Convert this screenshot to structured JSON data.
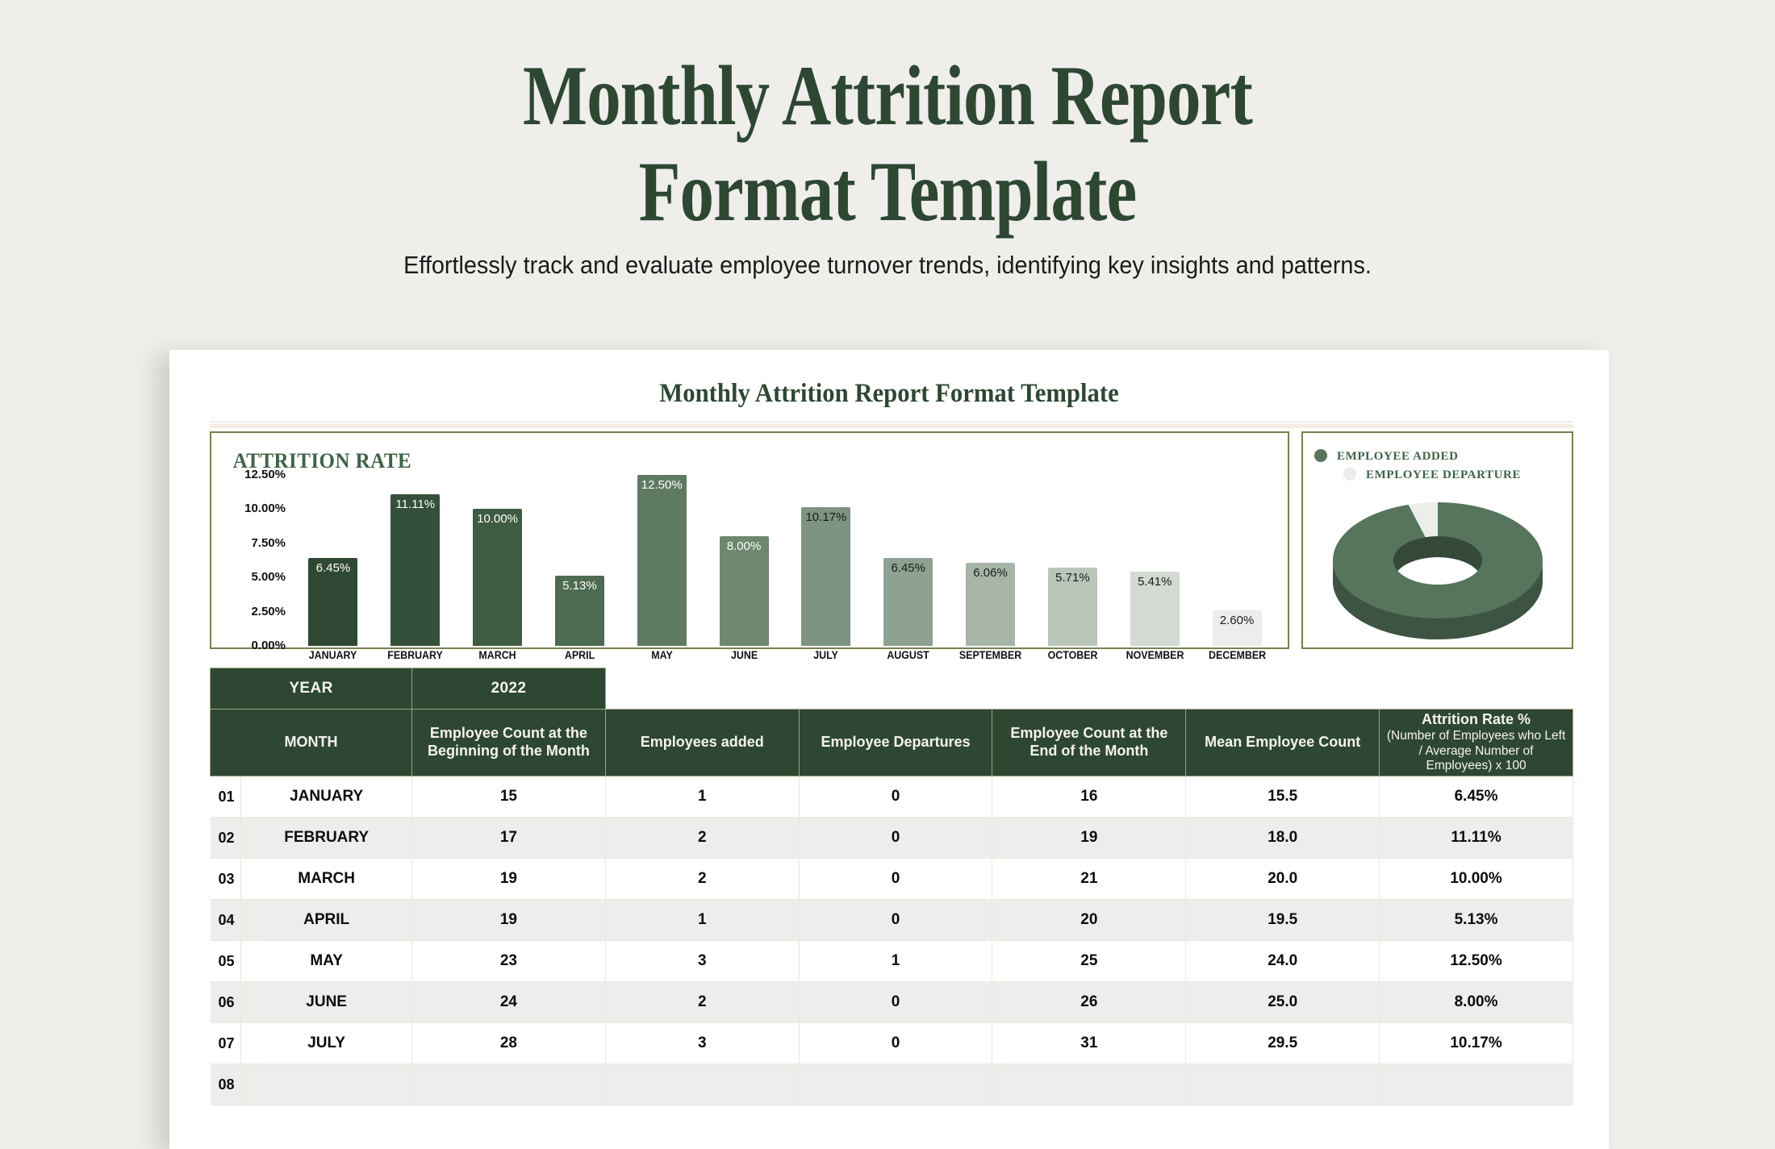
{
  "hero": {
    "title_line1": "Monthly Attrition Report",
    "title_line2": "Format Template",
    "subtitle": "Effortlessly track and evaluate employee turnover trends, identifying key insights and patterns."
  },
  "card": {
    "title": "Monthly Attrition Report Format Template"
  },
  "colors": {
    "brand_green": "#2d4733",
    "panel_border": "#7a7f4c",
    "page_bg": "#efeeea",
    "rule_pink": "#f7ece4",
    "header_text": "#f6f3ec",
    "alt_row": "#eceeeb"
  },
  "chart_data": [
    {
      "type": "bar",
      "title": "ATTRITION RATE",
      "xlabel": "",
      "ylabel": "",
      "ylim": [
        0,
        12.5
      ],
      "grid": false,
      "ytick_labels": [
        "12.50%",
        "10.00%",
        "7.50%",
        "5.00%",
        "2.50%",
        "0.00%"
      ],
      "ytick_values": [
        12.5,
        10.0,
        7.5,
        5.0,
        2.5,
        0.0
      ],
      "categories": [
        "JANUARY",
        "FEBRUARY",
        "MARCH",
        "APRIL",
        "MAY",
        "JUNE",
        "JULY",
        "AUGUST",
        "SEPTEMBER",
        "OCTOBER",
        "NOVEMBER",
        "DECEMBER"
      ],
      "values": [
        6.45,
        11.11,
        10.0,
        5.13,
        12.5,
        8.0,
        10.17,
        6.45,
        6.06,
        5.71,
        5.41,
        2.6
      ],
      "data_labels": [
        "6.45%",
        "11.11%",
        "10.00%",
        "5.13%",
        "12.50%",
        "8.00%",
        "10.17%",
        "6.45%",
        "6.06%",
        "5.71%",
        "5.41%",
        "2.60%"
      ],
      "bar_colors": [
        "#2f4833",
        "#35503a",
        "#3d5c42",
        "#4d6b51",
        "#5e7a61",
        "#6e8870",
        "#7d9480",
        "#8ea292",
        "#a6b5a7",
        "#bac5ba",
        "#d3dad1",
        "#eceeeb"
      ],
      "label_colors": [
        "#ffffff",
        "#ffffff",
        "#ffffff",
        "#ffffff",
        "#ffffff",
        "#ffffff",
        "#1b1b1b",
        "#1b1b1b",
        "#1b1b1b",
        "#1b1b1b",
        "#1b1b1b",
        "#1b1b1b"
      ]
    },
    {
      "type": "pie",
      "title": "",
      "legend_position": "top-left",
      "labels": [
        "EMPLOYEE ADDED",
        "EMPLOYEE DEPARTURE"
      ],
      "values": [
        95.5,
        4.5
      ],
      "slice_colors": [
        "#56755c",
        "#ebeeea"
      ]
    }
  ],
  "table": {
    "year_label": "YEAR",
    "year_value": "2022",
    "columns": [
      "MONTH",
      "Employee Count at the Beginning of the Month",
      "Employees added",
      "Employee Departures",
      "Employee Count at the End of the Month",
      "Mean Employee Count",
      "Attrition Rate %"
    ],
    "attrition_note": "(Number of Employees who Left / Average Number of Employees) x 100",
    "rows": [
      {
        "idx": "01",
        "month": "JANUARY",
        "begin": "15",
        "added": "1",
        "departures": "0",
        "end": "16",
        "mean": "15.5",
        "rate": "6.45%"
      },
      {
        "idx": "02",
        "month": "FEBRUARY",
        "begin": "17",
        "added": "2",
        "departures": "0",
        "end": "19",
        "mean": "18.0",
        "rate": "11.11%"
      },
      {
        "idx": "03",
        "month": "MARCH",
        "begin": "19",
        "added": "2",
        "departures": "0",
        "end": "21",
        "mean": "20.0",
        "rate": "10.00%"
      },
      {
        "idx": "04",
        "month": "APRIL",
        "begin": "19",
        "added": "1",
        "departures": "0",
        "end": "20",
        "mean": "19.5",
        "rate": "5.13%"
      },
      {
        "idx": "05",
        "month": "MAY",
        "begin": "23",
        "added": "3",
        "departures": "1",
        "end": "25",
        "mean": "24.0",
        "rate": "12.50%"
      },
      {
        "idx": "06",
        "month": "JUNE",
        "begin": "24",
        "added": "2",
        "departures": "0",
        "end": "26",
        "mean": "25.0",
        "rate": "8.00%"
      },
      {
        "idx": "07",
        "month": "JULY",
        "begin": "28",
        "added": "3",
        "departures": "0",
        "end": "31",
        "mean": "29.5",
        "rate": "10.17%"
      },
      {
        "idx": "08",
        "month": "",
        "begin": "",
        "added": "",
        "departures": "",
        "end": "",
        "mean": "",
        "rate": ""
      }
    ]
  }
}
